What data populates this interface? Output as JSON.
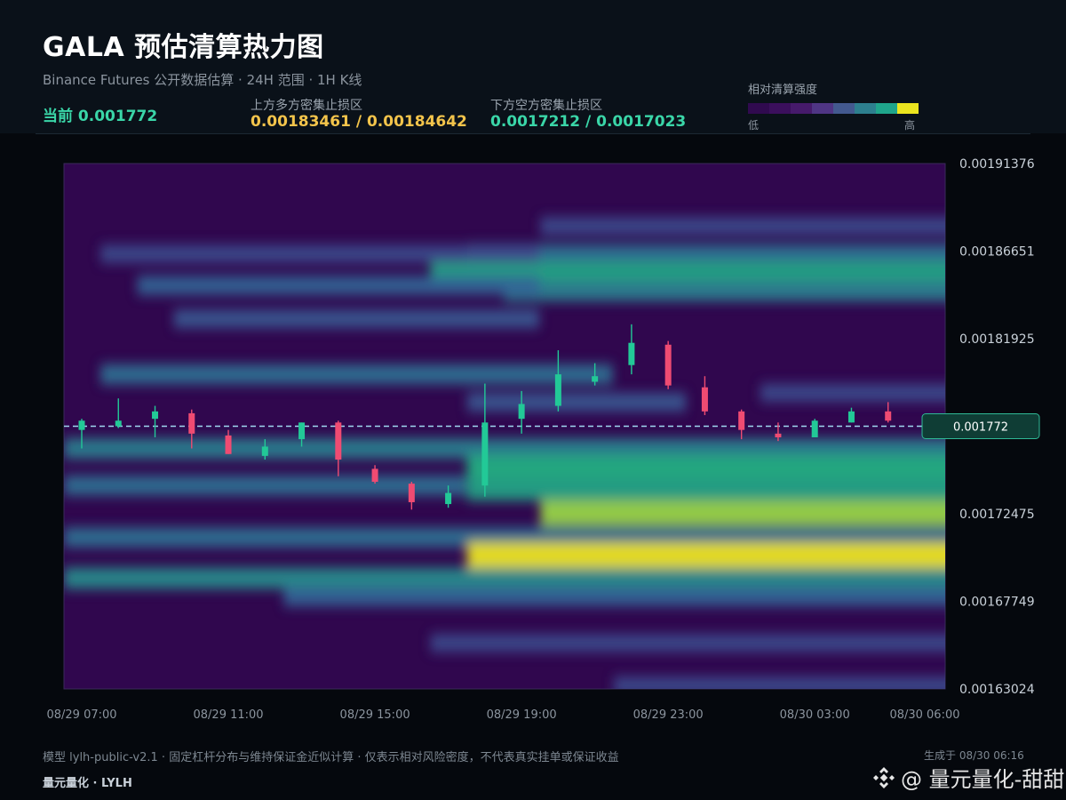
{
  "header": {
    "title": "GALA 预估清算热力图",
    "subtitle": "Binance Futures 公开数据估算 · 24H 范围 · 1H K线",
    "current": "当前 0.001772",
    "upper_label": "上方多方密集止损区",
    "upper_value": "0.00183461 / 0.00184642",
    "lower_label": "下方空方密集止损区",
    "lower_value": "0.0017212 / 0.0017023"
  },
  "legend": {
    "title": "相对清算强度",
    "low": "低",
    "high": "高",
    "colors": [
      "#300a4f",
      "#3b0f5c",
      "#461a6b",
      "#4f3584",
      "#43598f",
      "#2d7f8e",
      "#1fa58b",
      "#ece51f"
    ]
  },
  "footer": {
    "note": "模型 lylh-public-v2.1 · 固定杠杆分布与维持保证金近似计算 · 仅表示相对风险密度，不代表真实挂单或保证收益",
    "brand": "量元量化 · LYLH",
    "generated": "生成于 08/30 06:16",
    "watermark": "@ 量元量化-甜甜"
  },
  "chart_data": {
    "type": "heatmap",
    "title": "GALA 预估清算热力图",
    "y_range": [
      0.00163024,
      0.00191376
    ],
    "y_ticks": [
      "0.00191376",
      "0.00186651",
      "0.00181925",
      "0.00177200",
      "0.00172475",
      "0.00167749",
      "0.00163024"
    ],
    "y_tick_labels": [
      "0.00191376",
      "0.00186651",
      "0.00181925",
      "",
      "0.00172475",
      "0.00167749",
      "0.00163024"
    ],
    "x_ticks": [
      "08/29 07:00",
      "08/29 11:00",
      "08/29 15:00",
      "08/29 19:00",
      "08/29 23:00",
      "08/30 03:00",
      "08/30 06:00"
    ],
    "current_price": 0.001772,
    "current_price_label": "0.001772",
    "up_color": "#22c997",
    "down_color": "#ef4b72",
    "candles": [
      {
        "time": "08/29 07:00",
        "open": 0.00177,
        "high": 0.001776,
        "low": 0.00176,
        "close": 0.001775
      },
      {
        "time": "08/29 08:00",
        "open": 0.001772,
        "high": 0.001787,
        "low": 0.001771,
        "close": 0.001775
      },
      {
        "time": "08/29 09:00",
        "open": 0.001776,
        "high": 0.001783,
        "low": 0.001766,
        "close": 0.00178
      },
      {
        "time": "08/29 10:00",
        "open": 0.001779,
        "high": 0.001781,
        "low": 0.00176,
        "close": 0.001768
      },
      {
        "time": "08/29 11:00",
        "open": 0.001767,
        "high": 0.00177,
        "low": 0.001757,
        "close": 0.001757
      },
      {
        "time": "08/29 12:00",
        "open": 0.001756,
        "high": 0.001765,
        "low": 0.001754,
        "close": 0.001761
      },
      {
        "time": "08/29 13:00",
        "open": 0.001765,
        "high": 0.001774,
        "low": 0.001761,
        "close": 0.001774
      },
      {
        "time": "08/29 14:00",
        "open": 0.001774,
        "high": 0.001775,
        "low": 0.001745,
        "close": 0.001754
      },
      {
        "time": "08/29 15:00",
        "open": 0.001749,
        "high": 0.001751,
        "low": 0.001741,
        "close": 0.001742
      },
      {
        "time": "08/29 16:00",
        "open": 0.001741,
        "high": 0.001742,
        "low": 0.001727,
        "close": 0.001731
      },
      {
        "time": "08/29 17:00",
        "open": 0.00173,
        "high": 0.00174,
        "low": 0.001728,
        "close": 0.001736
      },
      {
        "time": "08/29 18:00",
        "open": 0.00174,
        "high": 0.001795,
        "low": 0.001734,
        "close": 0.001774
      },
      {
        "time": "08/29 19:00",
        "open": 0.001776,
        "high": 0.001791,
        "low": 0.001768,
        "close": 0.001784
      },
      {
        "time": "08/29 20:00",
        "open": 0.001783,
        "high": 0.001813,
        "low": 0.00178,
        "close": 0.0018
      },
      {
        "time": "08/29 21:00",
        "open": 0.001796,
        "high": 0.001806,
        "low": 0.001794,
        "close": 0.001799
      },
      {
        "time": "08/29 22:00",
        "open": 0.001805,
        "high": 0.001827,
        "low": 0.0018,
        "close": 0.001817
      },
      {
        "time": "08/29 23:00",
        "open": 0.001816,
        "high": 0.001818,
        "low": 0.001792,
        "close": 0.001794
      },
      {
        "time": "08/30 00:00",
        "open": 0.001793,
        "high": 0.001799,
        "low": 0.001778,
        "close": 0.00178
      },
      {
        "time": "08/30 01:00",
        "open": 0.00178,
        "high": 0.001781,
        "low": 0.001765,
        "close": 0.00177
      },
      {
        "time": "08/30 02:00",
        "open": 0.001768,
        "high": 0.001774,
        "low": 0.001764,
        "close": 0.001766
      },
      {
        "time": "08/30 03:00",
        "open": 0.001766,
        "high": 0.001776,
        "low": 0.001766,
        "close": 0.001775
      },
      {
        "time": "08/30 04:00",
        "open": 0.001774,
        "high": 0.001782,
        "low": 0.001774,
        "close": 0.00178
      },
      {
        "time": "08/30 05:00",
        "open": 0.00178,
        "high": 0.001785,
        "low": 0.001774,
        "close": 0.001775
      }
    ],
    "heat_bands": [
      {
        "price": 0.00188,
        "start": "08/29 20:00",
        "intensity": 0.35
      },
      {
        "price": 0.001865,
        "start": "08/29 18:00",
        "intensity": 0.5
      },
      {
        "price": 0.001855,
        "start": "08/29 17:00",
        "intensity": 0.7
      },
      {
        "price": 0.001845,
        "start": "08/29 19:00",
        "intensity": 0.55
      },
      {
        "price": 0.001865,
        "start": "08/29 08:00",
        "end": "08/29 19:00",
        "intensity": 0.35
      },
      {
        "price": 0.001848,
        "start": "08/29 09:00",
        "end": "08/29 19:00",
        "intensity": 0.45
      },
      {
        "price": 0.00183,
        "start": "08/29 10:00",
        "end": "08/29 19:00",
        "intensity": 0.4
      },
      {
        "price": 0.0018,
        "start": "08/29 08:00",
        "end": "08/29 21:00",
        "intensity": 0.5
      },
      {
        "price": 0.001785,
        "start": "08/29 18:00",
        "end": "08/29 23:00",
        "intensity": 0.4
      },
      {
        "price": 0.00179,
        "start": "08/30 02:00",
        "intensity": 0.35
      },
      {
        "price": 0.00176,
        "start": "08/29 07:00",
        "intensity": 0.55
      },
      {
        "price": 0.00175,
        "start": "08/29 18:00",
        "intensity": 0.75
      },
      {
        "price": 0.00174,
        "start": "08/29 07:00",
        "end": "08/29 17:00",
        "intensity": 0.5
      },
      {
        "price": 0.001738,
        "start": "08/29 18:00",
        "intensity": 0.7
      },
      {
        "price": 0.001725,
        "start": "08/29 20:00",
        "intensity": 0.92
      },
      {
        "price": 0.001712,
        "start": "08/29 07:00",
        "intensity": 0.5
      },
      {
        "price": 0.001702,
        "start": "08/29 18:00",
        "intensity": 1.0
      },
      {
        "price": 0.00169,
        "start": "08/29 07:00",
        "intensity": 0.6
      },
      {
        "price": 0.00168,
        "start": "08/29 13:00",
        "intensity": 0.45
      },
      {
        "price": 0.001655,
        "start": "08/29 17:00",
        "intensity": 0.35
      },
      {
        "price": 0.001632,
        "start": "08/29 22:00",
        "intensity": 0.35
      }
    ]
  }
}
